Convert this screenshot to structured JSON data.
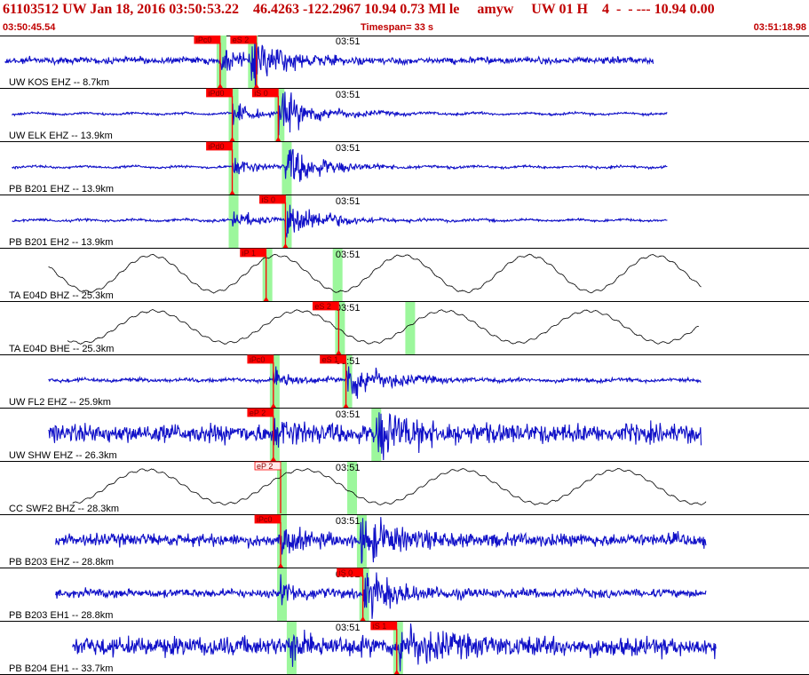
{
  "header": {
    "title": "61103512 UW Jan 18, 2016 03:50:53.22    46.4263 -122.2967 10.94 0.73 Ml le     amyw     UW 01 H    4  -  - --- 10.94 0.00",
    "start_time": "03:50:45.54",
    "timespan": "Timespan=  33 s",
    "end_time": "03:51:18.98"
  },
  "chart_data": {
    "type": "line",
    "x_unit": "seconds after 03:50:45.54",
    "xlim": [
      0,
      33.44
    ],
    "minute_tick": {
      "label": "03:51",
      "t": 14.46
    },
    "colors": {
      "trace_vel": "#1010c8",
      "trace_bb": "#000000",
      "pick": "#ff0000",
      "window": "#9cf79c"
    },
    "traces": [
      {
        "label": "UW KOS EHZ -- 8.7km",
        "kind": "vel",
        "start": 0.2,
        "end": 27.0,
        "p": 9.1,
        "s": 10.4,
        "noise": 0.14,
        "picks": [
          {
            "label": "iPc0",
            "t": 9.1,
            "solid": true
          },
          {
            "label": "eS 2",
            "t": 10.6,
            "solid": true
          }
        ]
      },
      {
        "label": "UW ELK EHZ -- 13.9km",
        "kind": "vel",
        "start": 0.5,
        "end": 27.6,
        "p": 9.6,
        "s": 11.5,
        "noise": 0.05,
        "picks": [
          {
            "label": "iPd0",
            "t": 9.6,
            "solid": true
          },
          {
            "label": "iS 0",
            "t": 11.5,
            "solid": true
          }
        ]
      },
      {
        "label": "PB B201 EHZ -- 13.9km",
        "kind": "vel",
        "start": 0.5,
        "end": 27.6,
        "p": 9.6,
        "s": 11.8,
        "noise": 0.05,
        "picks": [
          {
            "label": "iPd0",
            "t": 9.6,
            "solid": true
          }
        ]
      },
      {
        "label": "PB B201 EH2 -- 13.9km",
        "kind": "vel",
        "start": 0.5,
        "end": 27.6,
        "p": 9.6,
        "s": 11.8,
        "noise": 0.05,
        "picks": [
          {
            "label": "iS 0",
            "t": 11.8,
            "solid": true
          }
        ]
      },
      {
        "label": "TA E04D BHZ -- 25.3km",
        "kind": "bb",
        "start": 2.0,
        "end": 29.0,
        "period": 5.2,
        "amp": 0.85,
        "phase": 0.3,
        "picks": [
          {
            "label": "iP 1",
            "t": 11.0,
            "solid": true
          }
        ]
      },
      {
        "label": "TA E04D BHE -- 25.3km",
        "kind": "bb",
        "start": 2.8,
        "end": 28.9,
        "period": 6.0,
        "amp": 0.75,
        "phase": 1.2,
        "picks": [
          {
            "label": "eS 2",
            "t": 14.0,
            "solid": true
          }
        ]
      },
      {
        "label": "UW FL2 EHZ -- 25.9km",
        "kind": "vel",
        "start": 2.0,
        "end": 29.0,
        "p": 11.3,
        "s": 14.3,
        "noise": 0.08,
        "picks": [
          {
            "label": "iPc0",
            "t": 11.3,
            "solid": true
          },
          {
            "label": "eS 1",
            "t": 14.3,
            "solid": true
          }
        ]
      },
      {
        "label": "UW SHW EHZ -- 26.3km",
        "kind": "vel",
        "start": 2.0,
        "end": 29.0,
        "p": 11.3,
        "s": 15.5,
        "noise": 0.42,
        "picks": [
          {
            "label": "eP 2",
            "t": 11.3,
            "solid": true
          }
        ]
      },
      {
        "label": "CC SWF2 BHZ -- 28.3km",
        "kind": "bb",
        "start": 3.0,
        "end": 29.2,
        "period": 6.5,
        "amp": 0.8,
        "phase": 2.0,
        "picks": [
          {
            "label": "eP 2",
            "t": 11.6,
            "solid": false
          }
        ]
      },
      {
        "label": "PB B203 EHZ -- 28.8km",
        "kind": "vel",
        "start": 2.3,
        "end": 29.2,
        "p": 11.6,
        "s": 14.9,
        "noise": 0.28,
        "picks": [
          {
            "label": "iPc0",
            "t": 11.6,
            "solid": true
          }
        ]
      },
      {
        "label": "PB B203 EH1 -- 28.8km",
        "kind": "vel",
        "start": 2.3,
        "end": 29.2,
        "p": 11.6,
        "s": 15.0,
        "noise": 0.18,
        "picks": [
          {
            "label": "iS 0",
            "t": 15.0,
            "solid": true
          }
        ]
      },
      {
        "label": "PB B204 EH1 -- 33.7km",
        "kind": "vel",
        "start": 3.0,
        "end": 29.6,
        "p": 12.0,
        "s": 16.4,
        "noise": 0.42,
        "picks": [
          {
            "label": "iS 1",
            "t": 16.4,
            "solid": true
          }
        ]
      }
    ]
  }
}
